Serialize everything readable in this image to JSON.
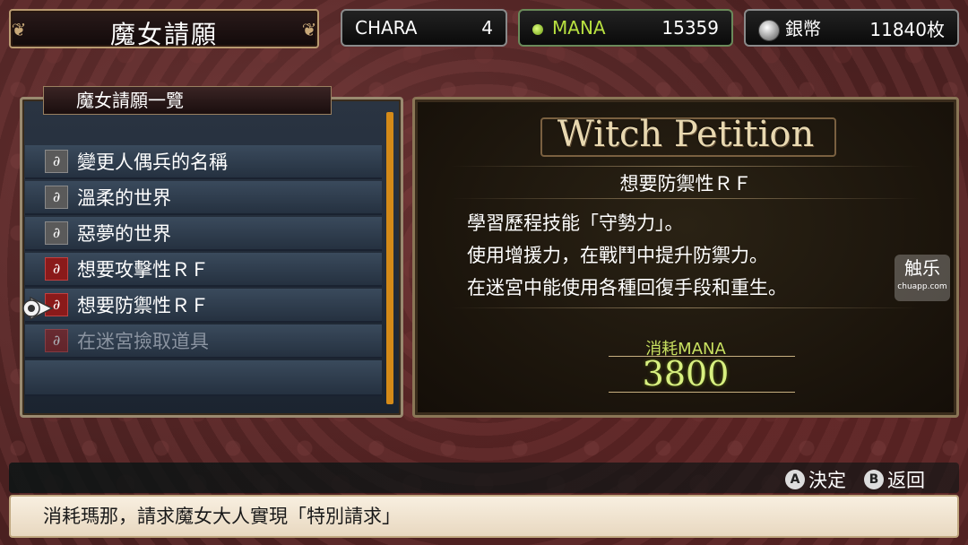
{
  "header": {
    "title": "魔女請願"
  },
  "stats": {
    "chara_label": "CHARA",
    "chara_value": "4",
    "mana_label": "MANA",
    "mana_value": "15359",
    "coin_label": "銀幣",
    "coin_value": "11840枚"
  },
  "list": {
    "heading": "魔女請願一覽",
    "items": [
      {
        "label": "變更人偶兵的名稱",
        "icon": "witch-seal-icon",
        "state": "normal"
      },
      {
        "label": "溫柔的世界",
        "icon": "witch-seal-icon",
        "state": "normal"
      },
      {
        "label": "惡夢的世界",
        "icon": "witch-seal-icon",
        "state": "normal"
      },
      {
        "label": "想要攻擊性ＲＦ",
        "icon": "witch-seal-icon-red",
        "state": "normal"
      },
      {
        "label": "想要防禦性ＲＦ",
        "icon": "witch-seal-icon-red",
        "state": "selected"
      },
      {
        "label": "在迷宮撿取道具",
        "icon": "witch-seal-icon-red",
        "state": "disabled"
      }
    ]
  },
  "detail": {
    "banner": "Witch Petition",
    "subtitle": "想要防禦性ＲＦ",
    "lines": [
      "學習歷程技能「守勢力」。",
      "使用增援力，在戰鬥中提升防禦力。",
      "在迷宮中能使用各種回復手段和重生。"
    ],
    "cost_label": "消耗MANA",
    "cost_value": "3800"
  },
  "controls": {
    "a_key": "A",
    "a_label": "決定",
    "b_key": "B",
    "b_label": "返回"
  },
  "message": "消耗瑪那，請求魔女大人實現「特別請求」",
  "watermark": {
    "main": "触乐",
    "sub": "chuapp.com"
  },
  "colors": {
    "mana": "#b8e040",
    "scroll": "#d48a18",
    "cost": "#d8f080"
  }
}
